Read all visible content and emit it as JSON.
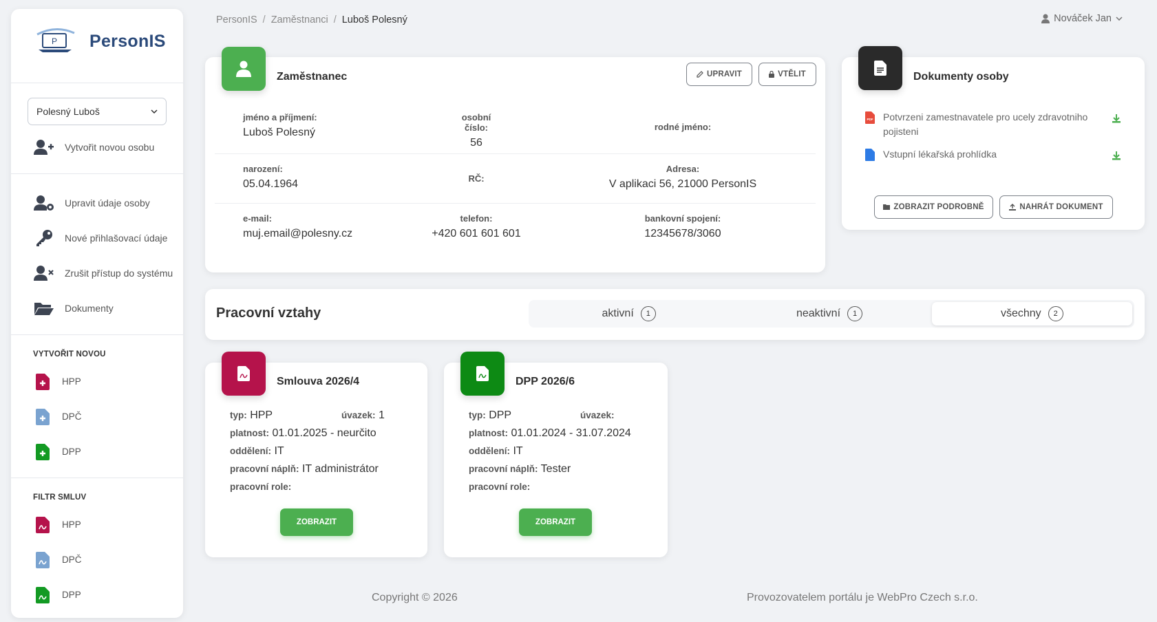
{
  "app": {
    "name": "PersonIS"
  },
  "sidebar": {
    "person_select": "Polesný Luboš",
    "create_person": "Vytvořit novou osobu",
    "actions": [
      {
        "label": "Upravit údaje osoby",
        "icon": "user-gear-icon"
      },
      {
        "label": "Nové přihlašovací údaje",
        "icon": "key-icon"
      },
      {
        "label": "Zrušit přístup do systému",
        "icon": "user-remove-icon"
      },
      {
        "label": "Dokumenty",
        "icon": "folder-open-icon"
      }
    ],
    "create_new_heading": "VYTVOŘIT NOVOU",
    "create_new": [
      {
        "label": "HPP",
        "color": "#b5134b"
      },
      {
        "label": "DPČ",
        "color": "#7aa3d0"
      },
      {
        "label": "DPP",
        "color": "#139a23"
      }
    ],
    "filter_heading": "FILTR SMLUV",
    "filter": [
      {
        "label": "HPP",
        "color": "#b5134b"
      },
      {
        "label": "DPČ",
        "color": "#7aa3d0"
      },
      {
        "label": "DPP",
        "color": "#139a23"
      }
    ]
  },
  "breadcrumb": [
    "PersonIS",
    "Zaměstnanci",
    "Luboš Polesný"
  ],
  "user_menu": "Nováček Jan",
  "employee": {
    "title": "Zaměstnanec",
    "edit_button": "UPRAVIT",
    "embed_button": "VTĚLIT",
    "fields": {
      "name_label": "jméno a příjmení:",
      "name_value": "Luboš Polesný",
      "number_label": "osobní číslo:",
      "number_value": "56",
      "birthname_label": "rodné jméno:",
      "birthname_value": "",
      "birth_label": "narození:",
      "birth_value": "05.04.1964",
      "rc_label": "RČ:",
      "rc_value": "",
      "address_label": "Adresa:",
      "address_value": "V aplikaci 56, 21000 PersonIS",
      "email_label": "e-mail:",
      "email_value": "muj.email@polesny.cz",
      "phone_label": "telefon:",
      "phone_value": "+420 601 601 601",
      "bank_label": "bankovní spojení:",
      "bank_value": "12345678/3060"
    }
  },
  "documents": {
    "title": "Dokumenty osoby",
    "items": [
      {
        "name": "Potvrzeni zamestnavatele pro ucely zdravotniho pojisteni",
        "type": "pdf"
      },
      {
        "name": "Vstupní lékařská prohlídka",
        "type": "doc"
      }
    ],
    "show_button": "ZOBRAZIT PODROBNĚ",
    "upload_button": "NAHRÁT DOKUMENT"
  },
  "relations": {
    "title": "Pracovní vztahy",
    "tabs": [
      {
        "label": "aktivní",
        "count": "1"
      },
      {
        "label": "neaktivní",
        "count": "1"
      },
      {
        "label": "všechny",
        "count": "2"
      }
    ],
    "active_tab": "všechny"
  },
  "contracts": [
    {
      "title": "Smlouva 2026/4",
      "color": "#b5134b",
      "typ_label": "typ:",
      "typ": "HPP",
      "uvazek_label": "úvazek:",
      "uvazek": "1",
      "platnost_label": "platnost:",
      "platnost": "01.01.2025 - neurčito",
      "oddeleni_label": "oddělení:",
      "oddeleni": "IT",
      "napln_label": "pracovní náplň:",
      "napln": "IT administrátor",
      "role_label": "pracovní role:",
      "role": "",
      "button": "ZOBRAZIT"
    },
    {
      "title": "DPP 2026/6",
      "color": "#0d8a14",
      "typ_label": "typ:",
      "typ": "DPP",
      "uvazek_label": "úvazek:",
      "uvazek": "",
      "platnost_label": "platnost:",
      "platnost": "01.01.2024 - 31.07.2024",
      "oddeleni_label": "oddělení:",
      "oddeleni": "IT",
      "napln_label": "pracovní náplň:",
      "napln": "Tester",
      "role_label": "pracovní role:",
      "role": "",
      "button": "ZOBRAZIT"
    }
  ],
  "footer": {
    "copyright": "Copyright © 2026",
    "operator": "Provozovatelem portálu je WebPro Czech s.r.o."
  }
}
